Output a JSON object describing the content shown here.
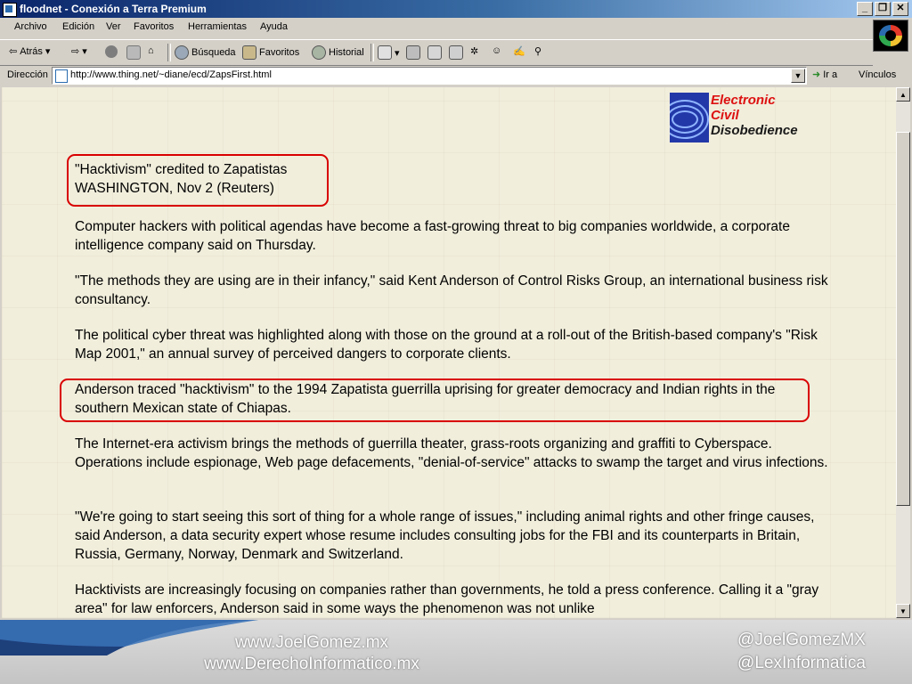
{
  "window": {
    "title": "floodnet - Conexión a Terra Premium",
    "minimize": "_",
    "maximize": "❐",
    "close": "✕"
  },
  "menu": [
    "Archivo",
    "Edición",
    "Ver",
    "Favoritos",
    "Herramientas",
    "Ayuda"
  ],
  "toolbar": {
    "back": "Atrás",
    "search": "Búsqueda",
    "favorites": "Favoritos",
    "history": "Historial"
  },
  "address": {
    "label": "Dirección",
    "url": "http://www.thing.net/~diane/ecd/ZapsFirst.html",
    "go": "Ir a",
    "links": "Vínculos"
  },
  "logo": {
    "line1_cap": "E",
    "line1": "lectronic",
    "line2_cap": "C",
    "line2": "ivil",
    "line3_cap": "D",
    "line3": "isobedience"
  },
  "article": {
    "headline": "\"Hacktivism\" credited to Zapatistas",
    "dateline": "WASHINGTON, Nov 2 (Reuters)",
    "paragraphs": [
      "Computer hackers with political agendas have become a fast-growing threat to big companies worldwide, a corporate intelligence company said on Thursday.",
      "\"The methods they are using are in their infancy,\" said Kent Anderson of Control Risks Group, an international business risk consultancy.",
      "The political cyber threat was highlighted along with those on the ground at a roll-out of the British-based company's \"Risk Map 2001,\" an annual survey of perceived dangers to corporate clients.",
      "Anderson traced \"hacktivism\" to the 1994 Zapatista guerrilla uprising for greater democracy and Indian rights in the southern Mexican state of Chiapas.",
      "The Internet-era activism brings the methods of guerrilla theater, grass-roots organizing and graffiti to Cyberspace. Operations include espionage, Web page defacements, \"denial-of-service\" attacks to swamp the target and virus infections.",
      "\"We're going to start seeing this sort of thing for a whole range of issues,\" including animal rights and other fringe causes, said Anderson, a data security expert whose resume includes consulting jobs for the FBI and its counterparts in Britain, Russia, Germany, Norway, Denmark and Switzerland.",
      "Hacktivists are increasingly focusing on companies rather than governments, he told a press conference. Calling it a \"gray area\" for law enforcers, Anderson said in some ways the phenomenon was not unlike"
    ]
  },
  "banner": {
    "site1": "www.JoelGomez.mx",
    "site2": "www.DerechoInformatico.mx",
    "handle1": "@JoelGomezMX",
    "handle2": "@LexInformatica"
  },
  "colors": {
    "page_bg": "#f1eedc",
    "highlight": "#d90000",
    "titlebar": "#0a246a"
  }
}
